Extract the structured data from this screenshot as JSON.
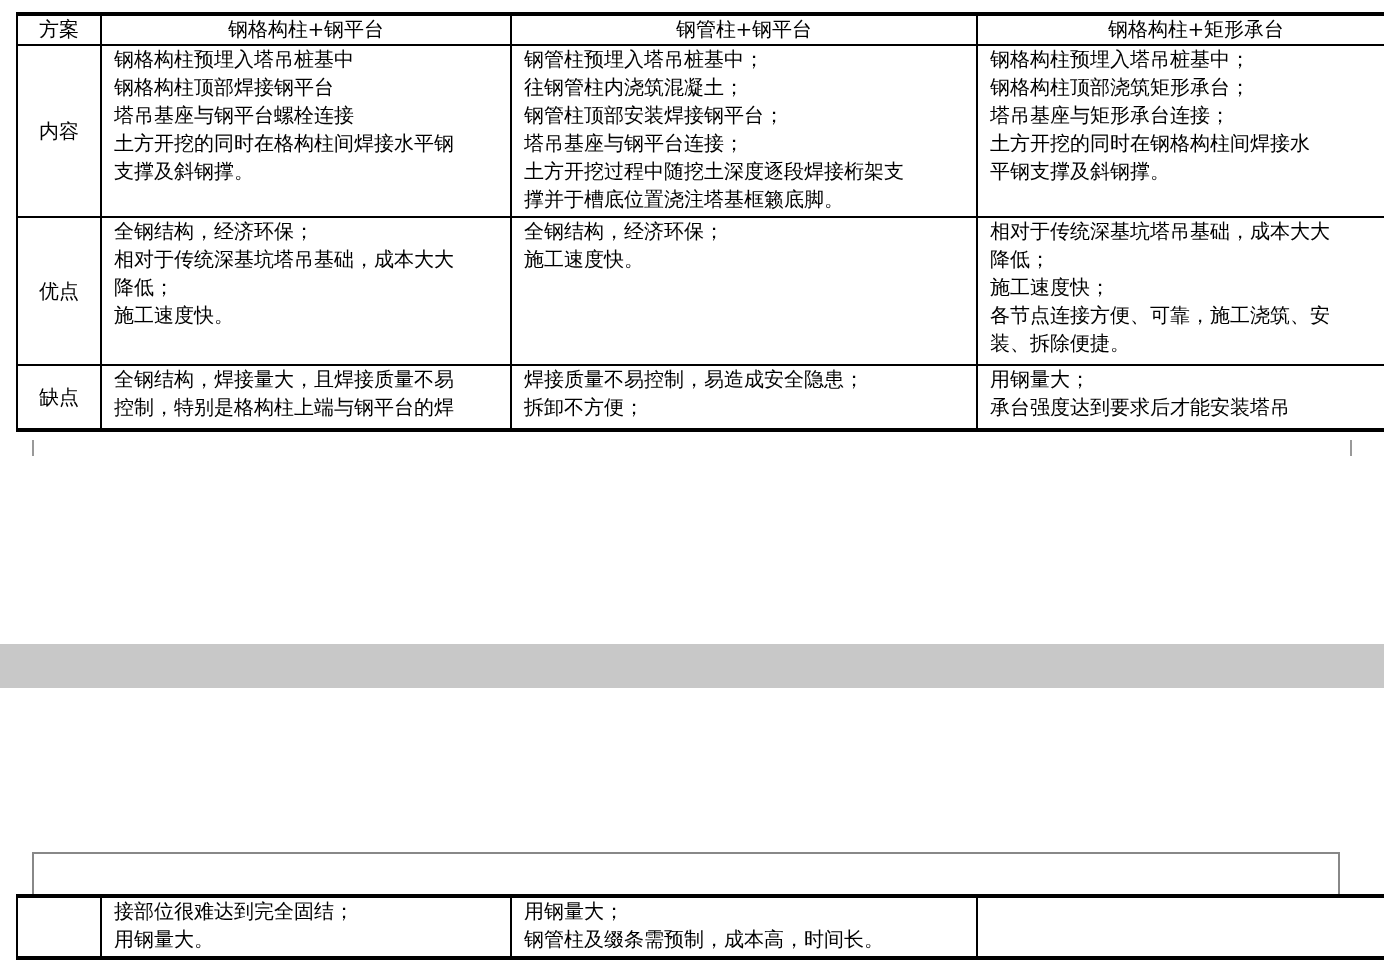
{
  "table": {
    "corner": "方案",
    "columns": [
      "钢格构柱+钢平台",
      "钢管柱+钢平台",
      "钢格构柱+矩形承台"
    ],
    "rows": [
      {
        "label": "内容",
        "cells": [
          [
            "钢格构柱预埋入塔吊桩基中",
            "钢格构柱顶部焊接钢平台",
            "塔吊基座与钢平台螺栓连接",
            "土方开挖的同时在格构柱间焊接水平钢",
            "支撑及斜钢撑。"
          ],
          [
            "钢管柱预埋入塔吊桩基中；",
            "往钢管柱内浇筑混凝土；",
            "钢管柱顶部安装焊接钢平台；",
            "塔吊基座与钢平台连接；",
            "土方开挖过程中随挖土深度逐段焊接桁架支",
            "撑并于槽底位置浇注塔基框籁底脚。"
          ],
          [
            "钢格构柱预埋入塔吊桩基中；",
            "钢格构柱顶部浇筑矩形承台；",
            "塔吊基座与矩形承台连接；",
            "土方开挖的同时在钢格构柱间焊接水",
            "平钢支撑及斜钢撑。"
          ]
        ]
      },
      {
        "label": "优点",
        "cells": [
          [
            "全钢结构，经济环保；",
            "相对于传统深基坑塔吊基础，成本大大",
            "降低；",
            "施工速度快。"
          ],
          [
            "全钢结构，经济环保；",
            "施工速度快。"
          ],
          [
            "相对于传统深基坑塔吊基础，成本大大",
            "降低；",
            "施工速度快；",
            "各节点连接方便、可靠，施工浇筑、安",
            "装、拆除便捷。"
          ]
        ]
      },
      {
        "label": "缺点",
        "cells": [
          [
            "全钢结构，焊接量大，且焊接质量不易",
            "控制，特别是格构柱上端与钢平台的焊"
          ],
          [
            "焊接质量不易控制，易造成安全隐患；",
            "拆卸不方便；"
          ],
          [
            "用钢量大；",
            "承台强度达到要求后才能安装塔吊"
          ]
        ]
      }
    ]
  },
  "continuation": {
    "cells": [
      [
        "接部位很难达到完全固结；",
        "用钢量大。"
      ],
      [
        "用钢量大；",
        "钢管柱及缀条需预制，成本高，时间长。"
      ],
      []
    ]
  }
}
